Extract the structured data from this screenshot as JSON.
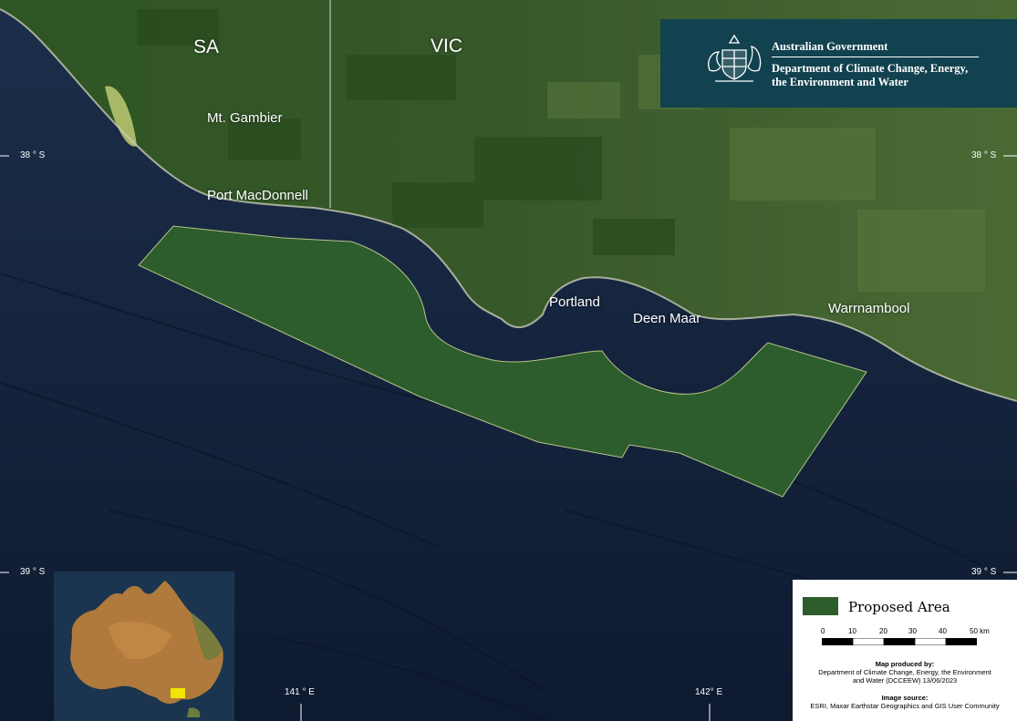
{
  "map": {
    "states": [
      "SA",
      "VIC"
    ],
    "places": [
      "Mt. Gambier",
      "Port MacDonnell",
      "Portland",
      "Deen Maar",
      "Warrnambool"
    ],
    "graticule": {
      "lat_38_left": "38 ° S",
      "lat_38_right": "38 ° S",
      "lat_39_left": "39 ° S",
      "lat_39_right": "39 ° S",
      "lon_141": "141 ° E",
      "lon_142": "142° E"
    }
  },
  "header": {
    "line1": "Australian Government",
    "line2": "Department of Climate Change, Energy,",
    "line3": "the Environment and Water",
    "bg_color": "#12424f"
  },
  "legend": {
    "area_label": "Proposed Area",
    "area_color": "#2d5d2c",
    "scale_ticks": [
      "0",
      "10",
      "20",
      "30",
      "40",
      "50 km"
    ],
    "produced_by_title": "Map produced by:",
    "produced_by_line1": "Department of Climate Change, Energy, the Environment",
    "produced_by_line2": "and Water (DCCEEW) 13/06/2023",
    "source_title": "Image source:",
    "source_text": "ESRI, Maxar Earthstar Geographics and GIS User Community"
  },
  "colors": {
    "ocean": "#0f1c33",
    "land": "#3c5a2a",
    "inset_marker": "#f2e500"
  }
}
